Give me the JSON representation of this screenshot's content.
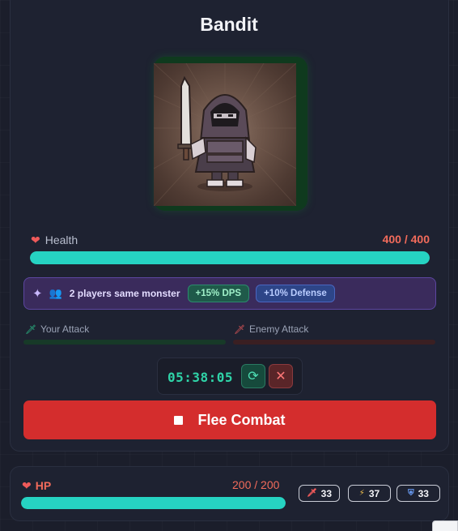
{
  "monster": {
    "name": "Bandit",
    "image_icon": "bandit-portrait",
    "health_label": "Health",
    "health_value": "400 / 400",
    "health_fraction": 1.0
  },
  "shared": {
    "text": "2 players same monster",
    "dps_badge": "+15% DPS",
    "defense_badge": "+10% Defense"
  },
  "attacks": {
    "your_label": "Your Attack",
    "enemy_label": "Enemy Attack",
    "your_progress": 0,
    "enemy_progress": 0
  },
  "timer": {
    "value": "05:38:05",
    "refresh_icon": "refresh-icon",
    "cancel_icon": "close-icon"
  },
  "flee": {
    "label": "Flee Combat",
    "icon": "stop-icon"
  },
  "player": {
    "hp_label": "HP",
    "hp_value": "200 / 200",
    "hp_fraction": 1.0,
    "attack": "33",
    "speed": "37",
    "defense": "33"
  },
  "colors": {
    "background": "#1b1e2b",
    "health_bar": "#26d3c2",
    "flee_button": "#d42d2d",
    "health_text": "#f26b5b",
    "portrait_frame": "#0f3a1e",
    "shared_banner": "#3a2b5c"
  }
}
